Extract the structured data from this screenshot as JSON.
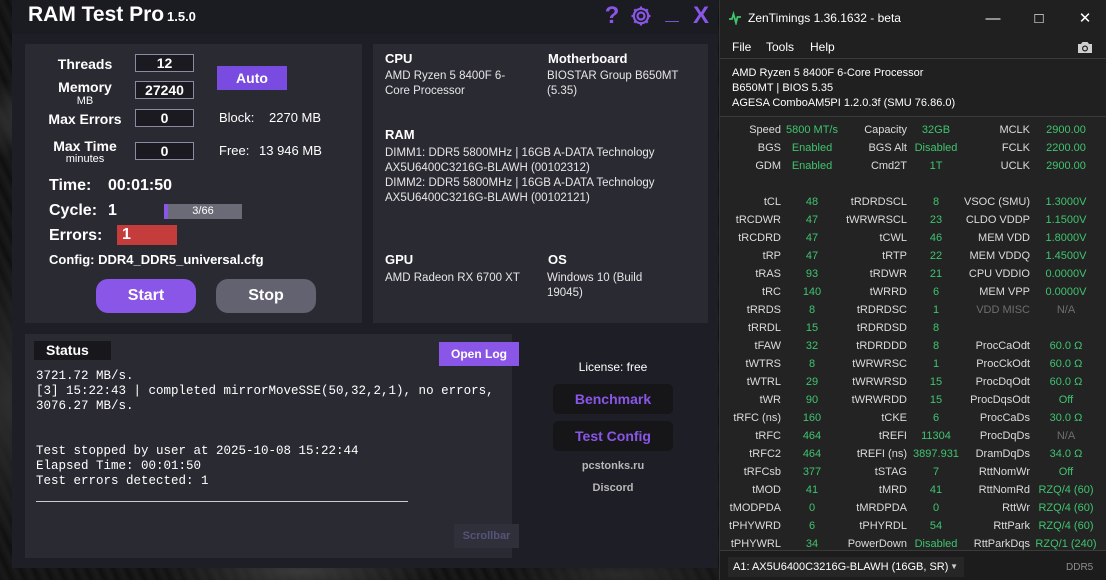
{
  "ramtest": {
    "title": "RAM Test Pro",
    "version": "1.5.0",
    "controls": {
      "help": "?",
      "minimize": "_",
      "close": "X"
    },
    "settings": {
      "threads_label": "Threads",
      "threads_value": "12",
      "memory_label": "Memory",
      "memory_unit": "MB",
      "memory_value": "27240",
      "max_errors_label": "Max Errors",
      "max_errors_value": "0",
      "max_time_label": "Max Time",
      "max_time_unit": "minutes",
      "max_time_value": "0",
      "auto_label": "Auto",
      "block_label": "Block:",
      "block_value": "2270 MB",
      "free_label": "Free:",
      "free_value": "13 946 MB",
      "time_label": "Time:",
      "time_value": "00:01:50",
      "cycle_label": "Cycle:",
      "cycle_value": "1",
      "progress_text": "3/66",
      "progress_fraction": 0.0455,
      "errors_label": "Errors:",
      "errors_value": "1",
      "config_text": "Config: DDR4_DDR5_universal.cfg",
      "start_label": "Start",
      "stop_label": "Stop"
    },
    "info": {
      "cpu_title": "CPU",
      "cpu_text": "AMD Ryzen 5 8400F 6-\nCore Processor",
      "mb_title": "Motherboard",
      "mb_text": "BIOSTAR Group B650MT\n(5.35)",
      "ram_title": "RAM",
      "ram_text": "DIMM1: DDR5 5800MHz | 16GB A-DATA Technology\nAX5U6400C3216G-BLAWH (00102312)\nDIMM2: DDR5 5800MHz | 16GB A-DATA Technology\nAX5U6400C3216G-BLAWH (00102121)",
      "gpu_title": "GPU",
      "gpu_text": "AMD Radeon RX 6700 XT",
      "os_title": "OS",
      "os_text": "Windows 10 (Build\n19045)"
    },
    "status": {
      "title": "Status",
      "open_log": "Open Log",
      "log": "3721.72 MB/s.\n[3] 15:22:43 | completed mirrorMoveSSE(50,32,2,1), no errors,\n3076.27 MB/s.\n\n\nTest stopped by user at 2025-10-08 15:22:44\nElapsed Time: 00:01:50\nTest errors detected: 1",
      "scrollbar": "Scrollbar"
    },
    "side": {
      "license": "License: free",
      "benchmark": "Benchmark",
      "test_config": "Test Config",
      "site": "pcstonks.ru",
      "discord": "Discord"
    },
    "accent": "#8a56e8"
  },
  "zen": {
    "title": "ZenTimings 1.36.1632 - beta",
    "menu": [
      "File",
      "Tools",
      "Help"
    ],
    "sys": [
      "AMD Ryzen 5 8400F 6-Core Processor",
      "B650MT | BIOS 5.35",
      "AGESA ComboAM5PI 1.2.0.3f (SMU 76.86.0)"
    ],
    "rows": [
      [
        "Speed",
        "5800 MT/s",
        "Capacity",
        "32GB",
        "MCLK",
        "2900.00"
      ],
      [
        "BGS",
        "Enabled",
        "BGS Alt",
        "Disabled",
        "FCLK",
        "2200.00"
      ],
      [
        "GDM",
        "Enabled",
        "Cmd2T",
        "1T",
        "UCLK",
        "2900.00"
      ],
      [
        "",
        "",
        "",
        "",
        "",
        ""
      ],
      [
        "tCL",
        "48",
        "tRDRDSCL",
        "8",
        "VSOC (SMU)",
        "1.3000V"
      ],
      [
        "tRCDWR",
        "47",
        "tWRWRSCL",
        "23",
        "CLDO VDDP",
        "1.1500V"
      ],
      [
        "tRCDRD",
        "47",
        "tCWL",
        "46",
        "MEM VDD",
        "1.8000V"
      ],
      [
        "tRP",
        "47",
        "tRTP",
        "22",
        "MEM VDDQ",
        "1.4500V"
      ],
      [
        "tRAS",
        "93",
        "tRDWR",
        "21",
        "CPU VDDIO",
        "0.0000V"
      ],
      [
        "tRC",
        "140",
        "tWRRD",
        "6",
        "MEM VPP",
        "0.0000V"
      ],
      [
        "tRRDS",
        "8",
        "tRDRDSC",
        "1",
        "VDD MISC",
        "N/A"
      ],
      [
        "tRRDL",
        "15",
        "tRDRDSD",
        "8",
        "",
        ""
      ],
      [
        "tFAW",
        "32",
        "tRDRDDD",
        "8",
        "ProcCaOdt",
        "60.0 Ω"
      ],
      [
        "tWTRS",
        "8",
        "tWRWRSC",
        "1",
        "ProcCkOdt",
        "60.0 Ω"
      ],
      [
        "tWTRL",
        "29",
        "tWRWRSD",
        "15",
        "ProcDqOdt",
        "60.0 Ω"
      ],
      [
        "tWR",
        "90",
        "tWRWRDD",
        "15",
        "ProcDqsOdt",
        "Off"
      ],
      [
        "tRFC (ns)",
        "160",
        "tCKE",
        "6",
        "ProcCaDs",
        "30.0 Ω"
      ],
      [
        "tRFC",
        "464",
        "tREFI",
        "11304",
        "ProcDqDs",
        "N/A"
      ],
      [
        "tRFC2",
        "464",
        "tREFI (ns)",
        "3897.931",
        "DramDqDs",
        "34.0 Ω"
      ],
      [
        "tRFCsb",
        "377",
        "tSTAG",
        "7",
        "RttNomWr",
        "Off"
      ],
      [
        "tMOD",
        "41",
        "tMRD",
        "41",
        "RttNomRd",
        "RZQ/4 (60)"
      ],
      [
        "tMODPDA",
        "0",
        "tMRDPDA",
        "0",
        "RttWr",
        "RZQ/4 (60)"
      ],
      [
        "tPHYWRD",
        "6",
        "tPHYRDL",
        "54",
        "RttPark",
        "RZQ/4 (60)"
      ],
      [
        "tPHYWRL",
        "34",
        "PowerDown",
        "Disabled",
        "RttParkDqs",
        "RZQ/1 (240)"
      ]
    ],
    "dimm_select": "A1: AX5U6400C3216G-BLAWH (16GB, SR)",
    "mem_type": "DDR5",
    "value_color": "#3fc46f"
  }
}
